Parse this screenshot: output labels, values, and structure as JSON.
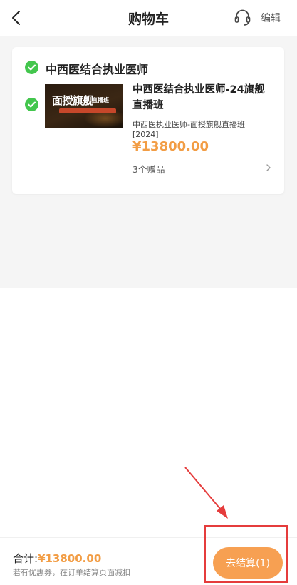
{
  "header": {
    "title": "购物车",
    "edit_label": "编辑",
    "back_icon": "chevron-left-icon",
    "service_icon": "headset-icon"
  },
  "cart": {
    "shop_name": "中西医结合执业医师",
    "item": {
      "title": "中西医结合执业医师-24旗舰直播班",
      "subtitle": "中西医执业医师-面授旗舰直播班[2024]",
      "price": "¥13800.00",
      "gifts": "3个赠品",
      "thumbnail": {
        "main_text": "面授旗舰",
        "tag_text": "直播班"
      }
    }
  },
  "footer": {
    "total_label": "合计:",
    "total_amount": "¥13800.00",
    "coupon_note": "若有优惠券，在订单结算页面减扣",
    "checkout_label": "去结算(1)"
  },
  "colors": {
    "accent": "#f29d45",
    "checkout_button": "#f7a052",
    "check_green": "#43c64d",
    "annotation_red": "#e53c3c"
  }
}
